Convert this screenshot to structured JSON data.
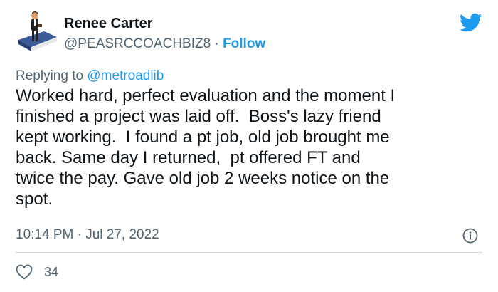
{
  "author": {
    "name": "Renee Carter",
    "handle": "@PEASRCCOACHBIZ8",
    "separator": " · ",
    "follow_label": "Follow"
  },
  "icons": {
    "brand": "twitter-bird-icon",
    "info": "info-icon",
    "like": "heart-icon"
  },
  "colors": {
    "accent": "#1d9bf0",
    "secondary_text": "#536471",
    "primary_text": "#0f1419"
  },
  "reply": {
    "prefix": "Replying to ",
    "handle": "@metroadlib"
  },
  "tweet": {
    "text": "Worked hard, perfect evaluation and the moment I\nfinished a project was laid off.  Boss's lazy friend\nkept working.  I found a pt job, old job brought me\nback. Same day I returned,  pt offered FT and\ntwice the pay. Gave old job 2 weeks notice on the\nspot.",
    "timestamp": "10:14 PM · Jul 27, 2022"
  },
  "actions": {
    "like_count": "34"
  }
}
